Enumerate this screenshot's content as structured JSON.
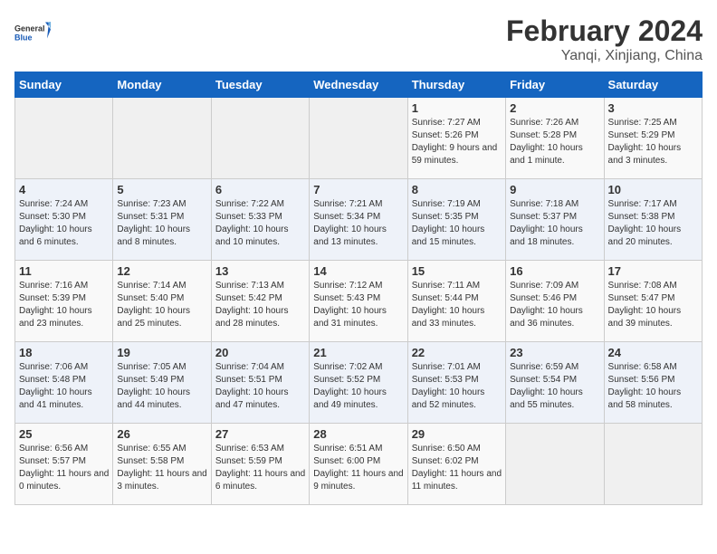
{
  "logo": {
    "name": "General",
    "name2": "Blue"
  },
  "title": "February 2024",
  "subtitle": "Yanqi, Xinjiang, China",
  "days_of_week": [
    "Sunday",
    "Monday",
    "Tuesday",
    "Wednesday",
    "Thursday",
    "Friday",
    "Saturday"
  ],
  "weeks": [
    [
      {
        "num": "",
        "empty": true
      },
      {
        "num": "",
        "empty": true
      },
      {
        "num": "",
        "empty": true
      },
      {
        "num": "",
        "empty": true
      },
      {
        "num": "1",
        "sunrise": "Sunrise: 7:27 AM",
        "sunset": "Sunset: 5:26 PM",
        "daylight": "Daylight: 9 hours and 59 minutes."
      },
      {
        "num": "2",
        "sunrise": "Sunrise: 7:26 AM",
        "sunset": "Sunset: 5:28 PM",
        "daylight": "Daylight: 10 hours and 1 minute."
      },
      {
        "num": "3",
        "sunrise": "Sunrise: 7:25 AM",
        "sunset": "Sunset: 5:29 PM",
        "daylight": "Daylight: 10 hours and 3 minutes."
      }
    ],
    [
      {
        "num": "4",
        "sunrise": "Sunrise: 7:24 AM",
        "sunset": "Sunset: 5:30 PM",
        "daylight": "Daylight: 10 hours and 6 minutes."
      },
      {
        "num": "5",
        "sunrise": "Sunrise: 7:23 AM",
        "sunset": "Sunset: 5:31 PM",
        "daylight": "Daylight: 10 hours and 8 minutes."
      },
      {
        "num": "6",
        "sunrise": "Sunrise: 7:22 AM",
        "sunset": "Sunset: 5:33 PM",
        "daylight": "Daylight: 10 hours and 10 minutes."
      },
      {
        "num": "7",
        "sunrise": "Sunrise: 7:21 AM",
        "sunset": "Sunset: 5:34 PM",
        "daylight": "Daylight: 10 hours and 13 minutes."
      },
      {
        "num": "8",
        "sunrise": "Sunrise: 7:19 AM",
        "sunset": "Sunset: 5:35 PM",
        "daylight": "Daylight: 10 hours and 15 minutes."
      },
      {
        "num": "9",
        "sunrise": "Sunrise: 7:18 AM",
        "sunset": "Sunset: 5:37 PM",
        "daylight": "Daylight: 10 hours and 18 minutes."
      },
      {
        "num": "10",
        "sunrise": "Sunrise: 7:17 AM",
        "sunset": "Sunset: 5:38 PM",
        "daylight": "Daylight: 10 hours and 20 minutes."
      }
    ],
    [
      {
        "num": "11",
        "sunrise": "Sunrise: 7:16 AM",
        "sunset": "Sunset: 5:39 PM",
        "daylight": "Daylight: 10 hours and 23 minutes."
      },
      {
        "num": "12",
        "sunrise": "Sunrise: 7:14 AM",
        "sunset": "Sunset: 5:40 PM",
        "daylight": "Daylight: 10 hours and 25 minutes."
      },
      {
        "num": "13",
        "sunrise": "Sunrise: 7:13 AM",
        "sunset": "Sunset: 5:42 PM",
        "daylight": "Daylight: 10 hours and 28 minutes."
      },
      {
        "num": "14",
        "sunrise": "Sunrise: 7:12 AM",
        "sunset": "Sunset: 5:43 PM",
        "daylight": "Daylight: 10 hours and 31 minutes."
      },
      {
        "num": "15",
        "sunrise": "Sunrise: 7:11 AM",
        "sunset": "Sunset: 5:44 PM",
        "daylight": "Daylight: 10 hours and 33 minutes."
      },
      {
        "num": "16",
        "sunrise": "Sunrise: 7:09 AM",
        "sunset": "Sunset: 5:46 PM",
        "daylight": "Daylight: 10 hours and 36 minutes."
      },
      {
        "num": "17",
        "sunrise": "Sunrise: 7:08 AM",
        "sunset": "Sunset: 5:47 PM",
        "daylight": "Daylight: 10 hours and 39 minutes."
      }
    ],
    [
      {
        "num": "18",
        "sunrise": "Sunrise: 7:06 AM",
        "sunset": "Sunset: 5:48 PM",
        "daylight": "Daylight: 10 hours and 41 minutes."
      },
      {
        "num": "19",
        "sunrise": "Sunrise: 7:05 AM",
        "sunset": "Sunset: 5:49 PM",
        "daylight": "Daylight: 10 hours and 44 minutes."
      },
      {
        "num": "20",
        "sunrise": "Sunrise: 7:04 AM",
        "sunset": "Sunset: 5:51 PM",
        "daylight": "Daylight: 10 hours and 47 minutes."
      },
      {
        "num": "21",
        "sunrise": "Sunrise: 7:02 AM",
        "sunset": "Sunset: 5:52 PM",
        "daylight": "Daylight: 10 hours and 49 minutes."
      },
      {
        "num": "22",
        "sunrise": "Sunrise: 7:01 AM",
        "sunset": "Sunset: 5:53 PM",
        "daylight": "Daylight: 10 hours and 52 minutes."
      },
      {
        "num": "23",
        "sunrise": "Sunrise: 6:59 AM",
        "sunset": "Sunset: 5:54 PM",
        "daylight": "Daylight: 10 hours and 55 minutes."
      },
      {
        "num": "24",
        "sunrise": "Sunrise: 6:58 AM",
        "sunset": "Sunset: 5:56 PM",
        "daylight": "Daylight: 10 hours and 58 minutes."
      }
    ],
    [
      {
        "num": "25",
        "sunrise": "Sunrise: 6:56 AM",
        "sunset": "Sunset: 5:57 PM",
        "daylight": "Daylight: 11 hours and 0 minutes."
      },
      {
        "num": "26",
        "sunrise": "Sunrise: 6:55 AM",
        "sunset": "Sunset: 5:58 PM",
        "daylight": "Daylight: 11 hours and 3 minutes."
      },
      {
        "num": "27",
        "sunrise": "Sunrise: 6:53 AM",
        "sunset": "Sunset: 5:59 PM",
        "daylight": "Daylight: 11 hours and 6 minutes."
      },
      {
        "num": "28",
        "sunrise": "Sunrise: 6:51 AM",
        "sunset": "Sunset: 6:00 PM",
        "daylight": "Daylight: 11 hours and 9 minutes."
      },
      {
        "num": "29",
        "sunrise": "Sunrise: 6:50 AM",
        "sunset": "Sunset: 6:02 PM",
        "daylight": "Daylight: 11 hours and 11 minutes."
      },
      {
        "num": "",
        "empty": true
      },
      {
        "num": "",
        "empty": true
      }
    ]
  ]
}
